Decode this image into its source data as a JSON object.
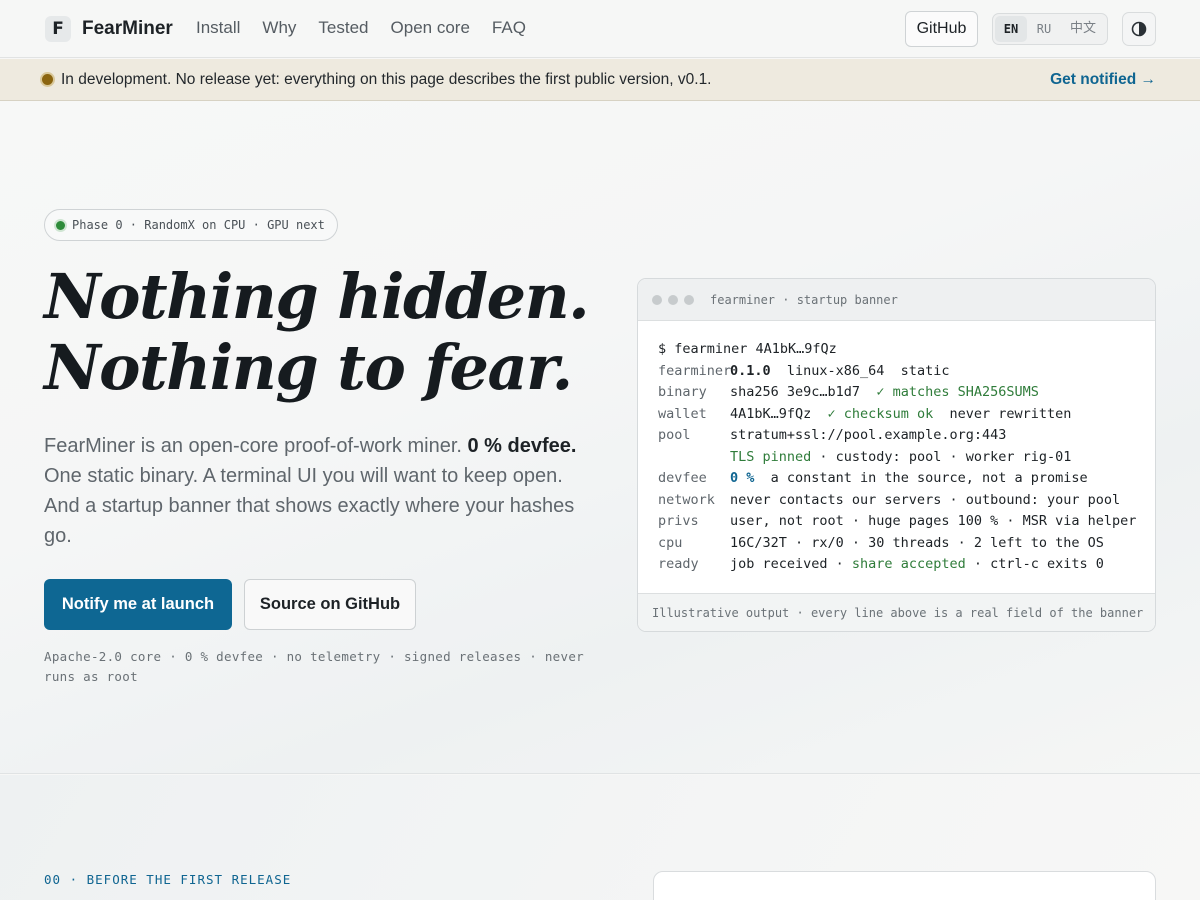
{
  "nav": {
    "logo_letter": "F",
    "brand": "FearMiner",
    "links": [
      "Install",
      "Why",
      "Tested",
      "Open core",
      "FAQ"
    ],
    "github": "GitHub",
    "langs": [
      "EN",
      "RU",
      "中文"
    ],
    "theme_icon": "contrast-icon"
  },
  "banner": {
    "message": "In development. No release yet: everything on this page describes the first public version, v0.1.",
    "cta": "Get notified →"
  },
  "hero": {
    "pill": "Phase 0 · RandomX on CPU · GPU next",
    "headline_1": "Nothing hidden.",
    "headline_2": "Nothing to fear.",
    "lead_1": "FearMiner is an open-core proof-of-work miner. ",
    "lead_bold": "0 % devfee.",
    "lead_2": " One static binary. A terminal UI you will want to keep open. And a startup banner that shows exactly where your hashes go.",
    "primary_button": "Notify me at launch",
    "secondary_button": "Source on GitHub",
    "facts": "Apache-2.0 core · 0 % devfee · no telemetry · signed releases · never runs as root"
  },
  "terminal": {
    "title": "fearminer · startup banner",
    "prompt": "$ fearminer 4A1bK…9fQz",
    "version_key": "fearminer",
    "version": "0.1.0",
    "version_rest": "  linux-x86_64  static",
    "binary_key": "binary",
    "binary_val": "sha256 3e9c…b1d7  ",
    "binary_ok": "✓ matches SHA256SUMS",
    "wallet_key": "wallet",
    "wallet_val": "4A1bK…9fQz  ",
    "wallet_ok": "✓ checksum ok",
    "wallet_rest": "  never rewritten",
    "pool_key": "pool",
    "pool_val": "stratum+ssl://pool.example.org:443",
    "pool_ok": "TLS pinned",
    "pool_rest": " · custody: pool · worker rig-01",
    "devfee_key": "devfee",
    "devfee_val": "0 %",
    "devfee_rest": "  a constant in the source, not a promise",
    "network_key": "network",
    "network_val": "never contacts our servers · outbound: your pool",
    "privs_key": "privs",
    "privs_val": "user, not root · huge pages 100 % · MSR via helper",
    "cpu_key": "cpu",
    "cpu_val": "16C/32T · rx/0 · 30 threads · 2 left to the OS",
    "ready_key": "ready",
    "ready_val": "job received · ",
    "ready_ok": "share accepted",
    "ready_rest": " · ctrl-c exits 0",
    "footer": "Illustrative output · every line above is a real field of the banner"
  },
  "next_section": {
    "eyebrow": "00 · BEFORE THE FIRST RELEASE"
  },
  "colors": {
    "accent": "#0e6793",
    "ok_green": "#2f7c3a",
    "status_dot": "#8b6510"
  }
}
